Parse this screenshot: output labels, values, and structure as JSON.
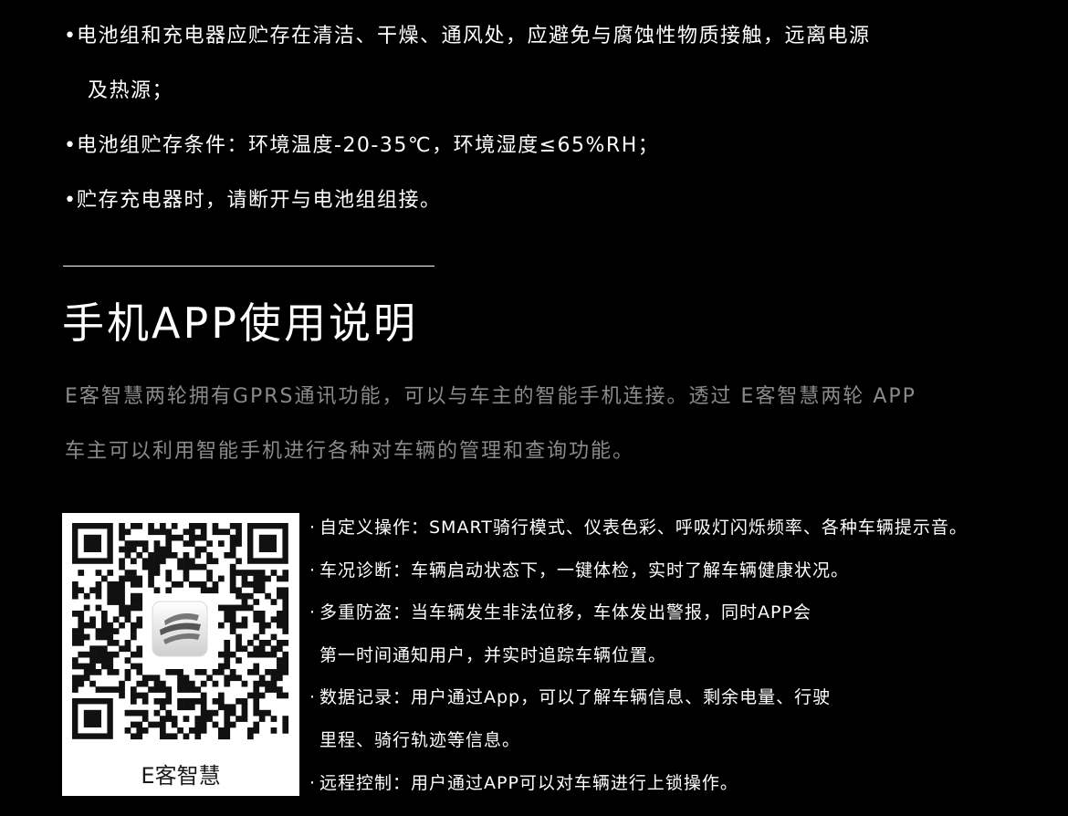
{
  "storage": {
    "bullet": "•",
    "items": [
      [
        "电池组和充电器应贮存在清洁、干燥、通风处，应避免与腐蚀性物质接触，远离电源",
        "及热源；"
      ],
      [
        "电池组贮存条件：环境温度-20-35℃，环境湿度≤65%RH；"
      ],
      [
        "贮存充电器时，请断开与电池组组接。"
      ]
    ]
  },
  "section": {
    "title": "手机APP使用说明"
  },
  "intro": {
    "lines": [
      "E客智慧两轮拥有GPRS通讯功能，可以与车主的智能手机连接。透过 E客智慧两轮 APP",
      "车主可以利用智能手机进行各种对车辆的管理和查询功能。"
    ]
  },
  "qr": {
    "caption": "E客智慧",
    "logo_icon": "e-logo-icon"
  },
  "features": {
    "bullet": "·",
    "items": [
      [
        "自定义操作：SMART骑行模式、仪表色彩、呼吸灯闪烁频率、各种车辆提示音。"
      ],
      [
        "车况诊断：车辆启动状态下，一键体检，实时了解车辆健康状况。"
      ],
      [
        "多重防盗：当车辆发生非法位移，车体发出警报，同时APP会",
        "第一时间通知用户，并实时追踪车辆位置。"
      ],
      [
        "数据记录：用户通过App，可以了解车辆信息、剩余电量、行驶",
        "里程、骑行轨迹等信息。"
      ],
      [
        "远程控制：用户通过APP可以对车辆进行上锁操作。"
      ]
    ]
  },
  "colors": {
    "background": "#000000",
    "text": "#ffffff",
    "muted_text": "#8a8a8a"
  }
}
